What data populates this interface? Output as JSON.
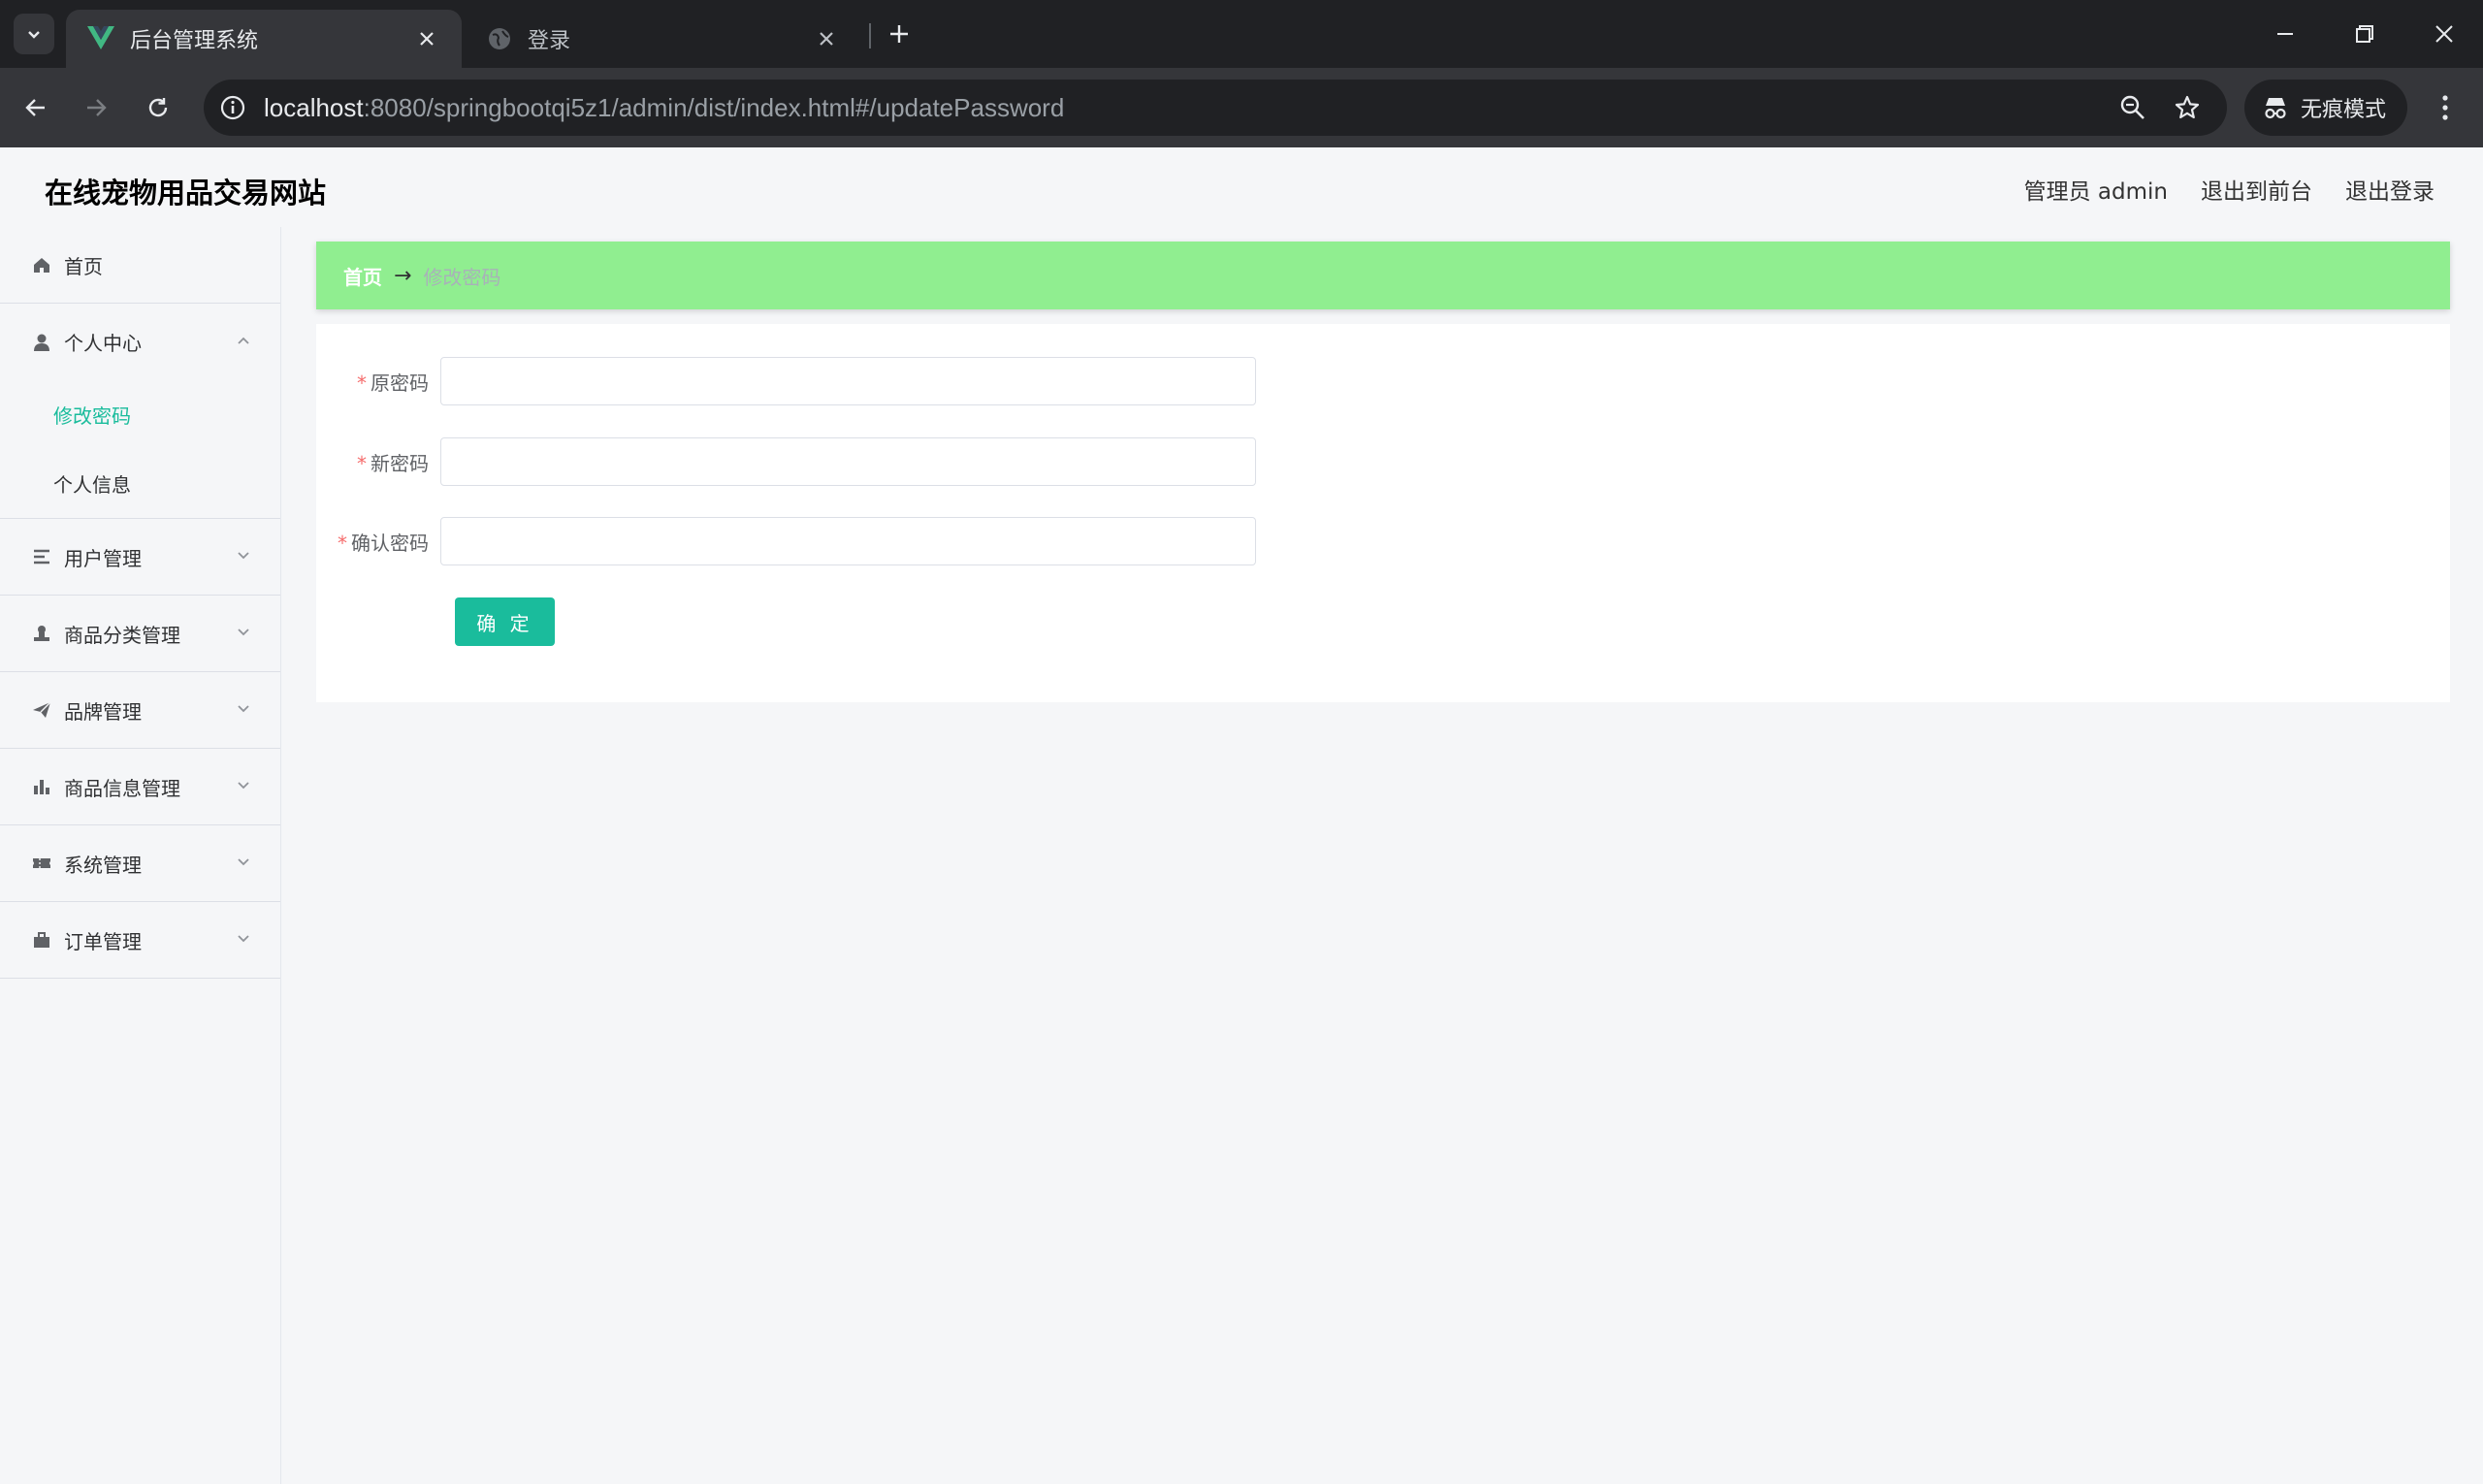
{
  "browser": {
    "tabs": [
      {
        "title": "后台管理系统",
        "active": true
      },
      {
        "title": "登录",
        "active": false
      }
    ],
    "url_host": "localhost",
    "url_rest": ":8080/springbootqi5z1/admin/dist/index.html#/updatePassword",
    "incognito_label": "无痕模式"
  },
  "header": {
    "site_title": "在线宠物用品交易网站",
    "user_label": "管理员 admin",
    "front_link": "退出到前台",
    "logout_link": "退出登录"
  },
  "sidebar": {
    "home": "首页",
    "personal_center": "个人中心",
    "personal_sub": [
      "修改密码",
      "个人信息"
    ],
    "items": [
      "用户管理",
      "商品分类管理",
      "品牌管理",
      "商品信息管理",
      "系统管理",
      "订单管理"
    ]
  },
  "breadcrumb": {
    "home": "首页",
    "separator": "→",
    "current": "修改密码"
  },
  "form": {
    "old_password_label": "原密码",
    "new_password_label": "新密码",
    "confirm_password_label": "确认密码",
    "required_mark": "*",
    "submit_label": "确 定"
  },
  "colors": {
    "accent": "#1abc9c",
    "breadcrumb_bg": "#90ee90",
    "required": "#f56c6c"
  }
}
